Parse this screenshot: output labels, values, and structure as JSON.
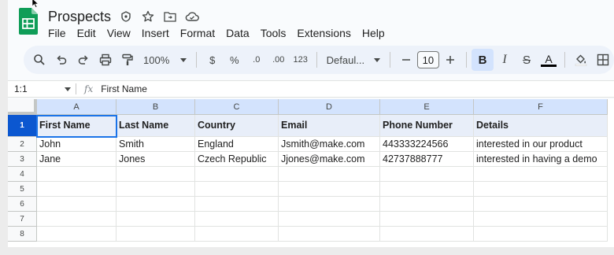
{
  "document": {
    "title": "Prospects",
    "title_icons": [
      "move-icon",
      "star-icon",
      "folder-icon",
      "cloud-icon"
    ]
  },
  "menu": [
    "File",
    "Edit",
    "View",
    "Insert",
    "Format",
    "Data",
    "Tools",
    "Extensions",
    "Help"
  ],
  "toolbar": {
    "zoom": "100%",
    "currency": "$",
    "percent": "%",
    "decrease_decimal": ".0",
    "increase_decimal": ".00",
    "number_format": "123",
    "font": "Defaul...",
    "font_size": "10",
    "bold": "B",
    "italic": "I",
    "strike": "S",
    "text_color_label": "A"
  },
  "formula_bar": {
    "name_box": "1:1",
    "fx": "fx",
    "value": "First Name"
  },
  "grid": {
    "columns": [
      "A",
      "B",
      "C",
      "D",
      "E",
      "F"
    ],
    "rows": [
      "1",
      "2",
      "3",
      "4",
      "5",
      "6",
      "7",
      "8"
    ],
    "header_row": [
      "First Name",
      "Last Name",
      "Country",
      "Email",
      "Phone Number",
      "Details"
    ],
    "data_rows": [
      [
        "John",
        "Smith",
        "England",
        "Jsmith@make.com",
        "443333224566",
        "interested in our product"
      ],
      [
        "Jane",
        "Jones",
        "Czech Republic",
        "Jjones@make.com",
        "42737888777",
        "interested in having a demo"
      ]
    ]
  }
}
